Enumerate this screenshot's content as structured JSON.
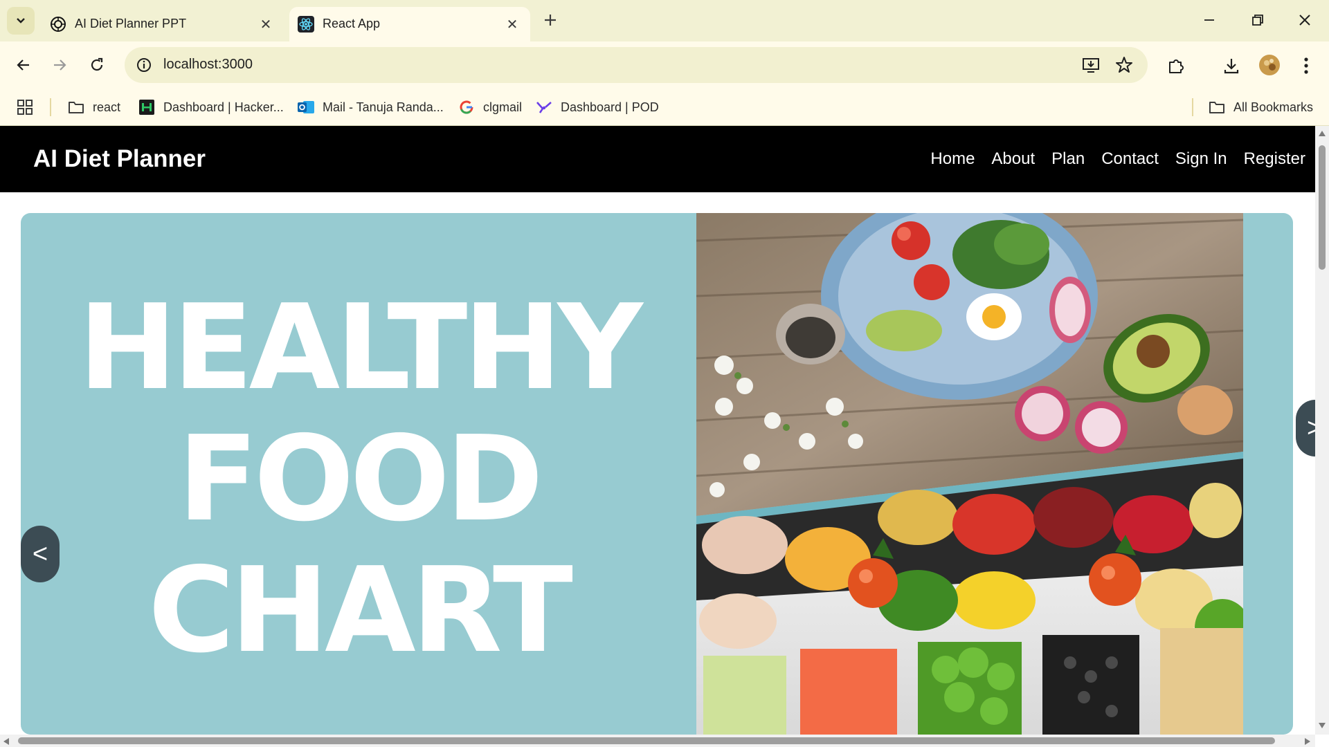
{
  "browser": {
    "tabs": [
      {
        "title": "AI Diet Planner PPT",
        "icon": "openai-icon",
        "active": false
      },
      {
        "title": "React App",
        "icon": "react-icon",
        "active": true
      }
    ],
    "address": "localhost:3000",
    "bookmarks": [
      {
        "label": "react",
        "icon": "folder-icon"
      },
      {
        "label": "Dashboard | Hacker...",
        "icon": "hackerrank-icon"
      },
      {
        "label": "Mail - Tanuja Randa...",
        "icon": "outlook-icon"
      },
      {
        "label": "clgmail",
        "icon": "google-icon"
      },
      {
        "label": "Dashboard | POD",
        "icon": "pod-icon"
      }
    ],
    "all_bookmarks": "All Bookmarks"
  },
  "site": {
    "brand": "AI Diet Planner",
    "nav": [
      "Home",
      "About",
      "Plan",
      "Contact",
      "Sign In",
      "Register"
    ]
  },
  "carousel": {
    "headline_lines": [
      "HEALTHY",
      "FOOD",
      "CHART"
    ],
    "prev_label": "<",
    "next_label": ">",
    "background": "#97cbd1"
  }
}
